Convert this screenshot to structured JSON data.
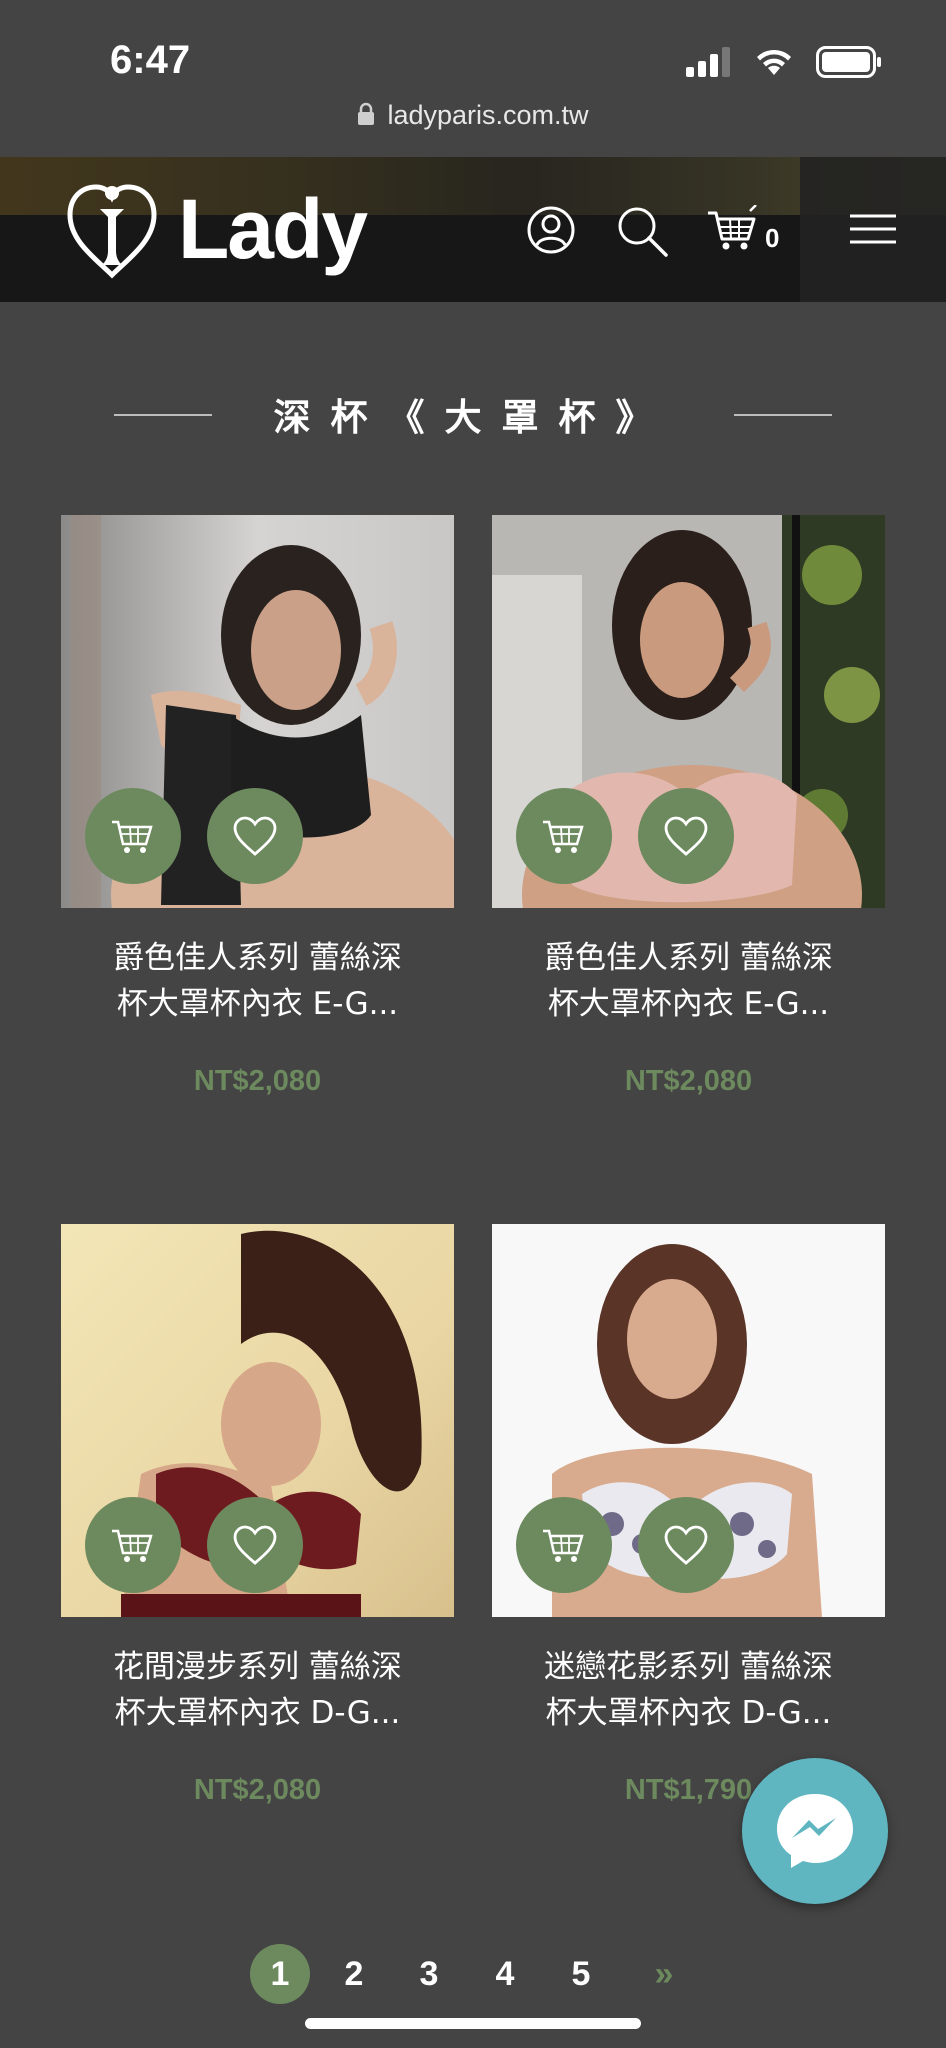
{
  "status_bar": {
    "time": "6:47"
  },
  "browser": {
    "url": "ladyparis.com.tw"
  },
  "header": {
    "logo_text": "Lady",
    "cart_count": "0"
  },
  "section": {
    "title": "深杯《大罩杯》"
  },
  "products": [
    {
      "name_line1": "爵色佳人系列 蕾絲深",
      "name_line2": "杯大罩杯內衣 E-G...",
      "price": "NT$2,080"
    },
    {
      "name_line1": "爵色佳人系列 蕾絲深",
      "name_line2": "杯大罩杯內衣 E-G...",
      "price": "NT$2,080"
    },
    {
      "name_line1": "花間漫步系列 蕾絲深",
      "name_line2": "杯大罩杯內衣 D-G...",
      "price": "NT$2,080"
    },
    {
      "name_line1": "迷戀花影系列 蕾絲深",
      "name_line2": "杯大罩杯內衣 D-G...",
      "price": "NT$1,790"
    }
  ],
  "pagination": {
    "pages": [
      "1",
      "2",
      "3",
      "4",
      "5"
    ],
    "current": "1",
    "next": "»"
  },
  "colors": {
    "background": "#444444",
    "accent": "#6d8a5f",
    "header": "#171717",
    "messenger": "#5fb6c1"
  }
}
